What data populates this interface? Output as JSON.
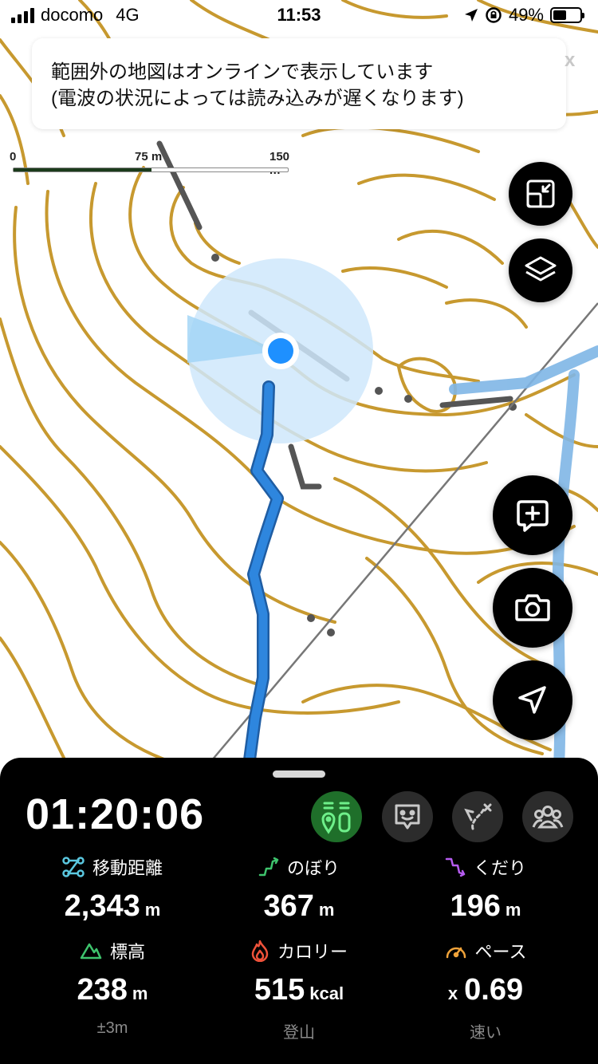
{
  "status_bar": {
    "carrier": "docomo",
    "network": "4G",
    "time": "11:53",
    "battery": "49%",
    "battery_level": 0.49
  },
  "map": {
    "notice": {
      "line1": "範囲外の地図はオンラインで表示しています",
      "line2": "(電波の状況によっては読み込みが遅くなります)",
      "close": "x"
    },
    "scale": {
      "labels": [
        "0",
        "75 m",
        "150 m"
      ]
    },
    "colors": {
      "contour": "#c7992f",
      "track": "#2e86de",
      "route": "#7fb6e6",
      "accuracy": "#cfe8fb",
      "location_dot": "#1e90ff"
    },
    "buttons": {
      "fit": "fit-view-icon",
      "layers": "layers-icon",
      "add_memo": "add-memo-icon",
      "camera": "camera-icon",
      "locate": "locate-icon"
    }
  },
  "panel": {
    "elapsed_time": "01:20:06",
    "modes": [
      "route-pin-icon",
      "face-icon",
      "branch-route-icon",
      "group-icon"
    ],
    "stats": [
      {
        "label": "移動距離",
        "value": "2,343",
        "unit": "m",
        "icon": "distance-icon",
        "icon_color": "#5bc8e0"
      },
      {
        "label": "のぼり",
        "value": "367",
        "unit": "m",
        "icon": "ascent-icon",
        "icon_color": "#3ec46d"
      },
      {
        "label": "くだり",
        "value": "196",
        "unit": "m",
        "icon": "descent-icon",
        "icon_color": "#b65cf0"
      },
      {
        "label": "標高",
        "value": "238",
        "unit": "m",
        "sub": "±3m",
        "icon": "mountain-icon",
        "icon_color": "#3ec46d"
      },
      {
        "label": "カロリー",
        "value": "515",
        "unit": "kcal",
        "sub": "登山",
        "icon": "flame-icon",
        "icon_color": "#f0523a"
      },
      {
        "label": "ペース",
        "prefix": "x",
        "value": "0.69",
        "unit": "",
        "sub": "速い",
        "icon": "speedometer-icon",
        "icon_color": "#f0a33a"
      }
    ]
  }
}
